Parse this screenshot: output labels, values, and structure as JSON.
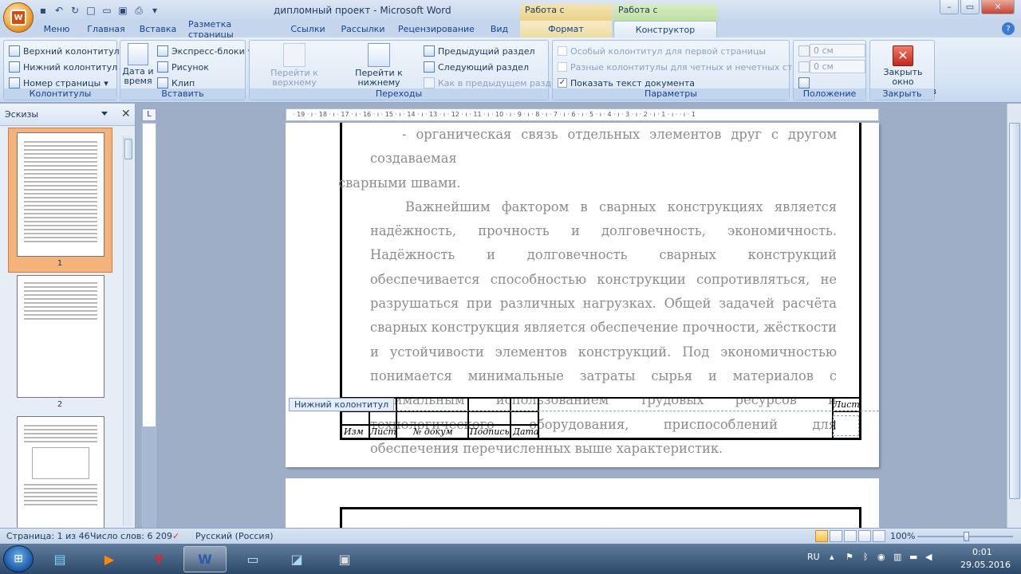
{
  "titlebar": {
    "title": "дипломный проект - Microsoft Word",
    "context_tab_1": "Работа с надписями",
    "context_tab_2": "Работа с колонтитулами",
    "window_buttons": {
      "minimize": "–",
      "maximize": "▭",
      "close": "✕"
    }
  },
  "tabs": [
    {
      "label": "Меню"
    },
    {
      "label": "Главная"
    },
    {
      "label": "Вставка"
    },
    {
      "label": "Разметка страницы"
    },
    {
      "label": "Ссылки"
    },
    {
      "label": "Рассылки"
    },
    {
      "label": "Рецензирование"
    },
    {
      "label": "Вид"
    },
    {
      "label": "Формат"
    },
    {
      "label": "Конструктор"
    }
  ],
  "ribbon": {
    "kolontituly": {
      "label": "Колонтитулы",
      "header": "Верхний колонтитул",
      "footer": "Нижний колонтитул",
      "page_number": "Номер страницы"
    },
    "insert": {
      "label": "Вставить",
      "date_time": "Дата и время",
      "express_blocks": "Экспресс-блоки",
      "picture": "Рисунок",
      "clip": "Клип"
    },
    "navigation": {
      "label": "Переходы",
      "goto_header": "Перейти к верхнему колонтитулу",
      "goto_footer": "Перейти к нижнему колонтитулу",
      "prev_section": "Предыдущий раздел",
      "next_section": "Следующий раздел",
      "link_prev": "Как в предыдущем разделе"
    },
    "options": {
      "label": "Параметры",
      "first_page": "Особый колонтитул для первой страницы",
      "odd_even": "Разные колонтитулы для четных и нечетных страниц",
      "show_text": "Показать текст документа"
    },
    "position": {
      "label": "Положение",
      "header_value": "0 см",
      "footer_value": "0 см"
    },
    "close": {
      "label": "Закрыть",
      "close_button": "Закрыть окно колонтитулов"
    }
  },
  "thumbnails": {
    "title": "Эскизы",
    "pages": [
      "1",
      "2"
    ]
  },
  "ruler": {
    "ticks": "· 19 · ı · 18 · ı · 17 · ı · 16 · ı · 15 · ı · 14 · ı · 13 · ı · 12 · ı · 11 · ı · 10 · ı · 9 · ı · 8 · ı · 7 · ı · 6 · ı · 5 · ı · 4 · ı · 3 · ı · 2 · ı · 1 · ı ·   · ı · 1"
  },
  "document": {
    "line1": "- органическая связь отдельных элементов друг с другом создаваемая",
    "line1_cont": "сварными швами.",
    "para2": "Важнейшим фактором в сварных конструкциях является надёжность, прочность и долговечность, экономичность. Надёжность и долговечность сварных конструкций обеспечивается способностью конструкции сопротивляться, не разрушаться при различных нагрузках. Общей задачей расчёта сварных конструкция является обеспечение прочности, жёсткости и устойчивости элементов конструкций. Под экономичностью понимается минимальные затраты сырья и материалов с оптимальным использованием трудовых ресурсов и технологического оборудования, приспособлений для обеспечения перечисленных выше характеристик.",
    "footer_tag": "Нижний колонтитул",
    "stamp": {
      "izm": "Изм",
      "list": "Лист",
      "doc_no": "№ докум",
      "signature": "Подпись",
      "date": "Дата",
      "sheet": "Лист"
    }
  },
  "statusbar": {
    "page": "Страница: 1 из 46",
    "words": "Число слов: 6 209",
    "language": "Русский (Россия)",
    "zoom": "100%"
  },
  "taskbar": {
    "lang": "RU",
    "time": "0:01",
    "date": "29.05.2016"
  }
}
